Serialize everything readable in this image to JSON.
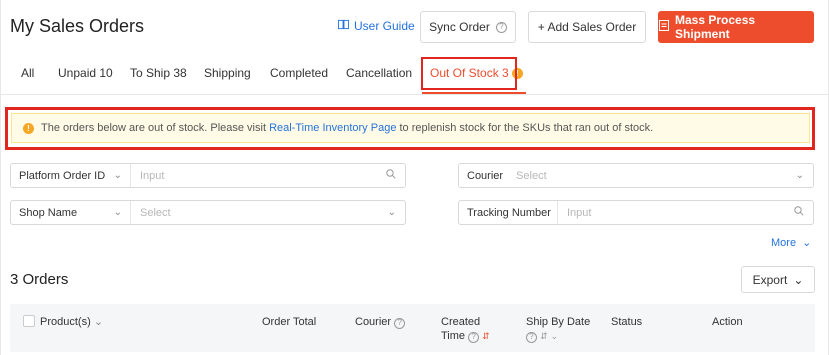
{
  "header": {
    "title": "My Sales Orders",
    "user_guide": "User Guide",
    "sync_order": "Sync Order",
    "add_sales_order": "+ Add Sales Order",
    "mass_process": "Mass Process Shipment"
  },
  "tabs": [
    {
      "label": "All"
    },
    {
      "label": "Unpaid 10"
    },
    {
      "label": "To Ship 38"
    },
    {
      "label": "Shipping"
    },
    {
      "label": "Completed"
    },
    {
      "label": "Cancellation"
    },
    {
      "label": "Out Of Stock 3",
      "active": true
    }
  ],
  "alert": {
    "before": "The orders below are out of stock. Please visit ",
    "link": "Real-Time Inventory Page",
    "after": " to replenish stock for the SKUs that ran out of stock."
  },
  "filters": {
    "order_id_select": "Platform Order ID",
    "order_id_placeholder": "Input",
    "courier_label": "Courier",
    "courier_placeholder": "Select",
    "shop_select": "Shop Name",
    "shop_placeholder": "Select",
    "tracking_label": "Tracking Number",
    "tracking_placeholder": "Input",
    "more": "More"
  },
  "orders": {
    "count_label": "3 Orders",
    "export": "Export"
  },
  "table": {
    "columns": {
      "product": "Product(s)",
      "order_total": "Order Total",
      "courier": "Courier",
      "created_1": "Created",
      "created_2": "Time",
      "ship_by": "Ship By Date",
      "status": "Status",
      "action": "Action"
    }
  },
  "colors": {
    "brand": "#ee4d2d",
    "link": "#2673dd",
    "highlight_box": "#e0261f",
    "alert_bg": "#fffbe6",
    "warning": "#f5a623"
  }
}
